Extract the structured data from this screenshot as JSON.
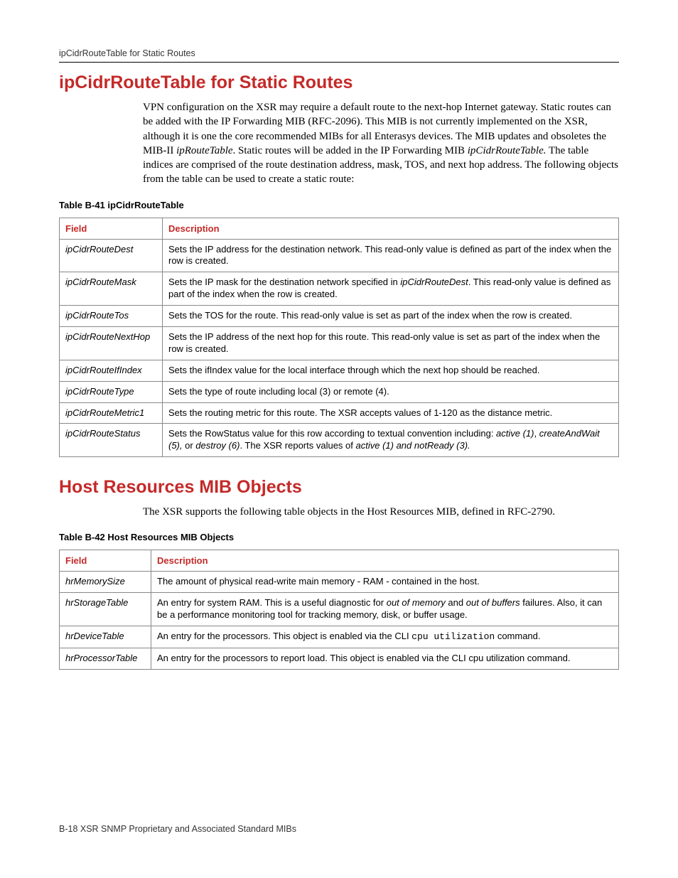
{
  "header": {
    "running": "ipCidrRouteTable for Static Routes"
  },
  "section1": {
    "title": "ipCidrRouteTable for Static Routes",
    "para_parts": [
      {
        "t": "VPN configuration on the XSR may require a default route to the next-hop Internet gateway. Static routes can be added with the IP Forwarding MIB (RFC-2096). This MIB is not currently implemented on the XSR, although it is one the core recommended MIBs for all Enterasys devices. The MIB updates and obsoletes the MIB-II "
      },
      {
        "t": "ipRouteTable",
        "i": true
      },
      {
        "t": ". Static routes will be added in the IP Forwarding MIB "
      },
      {
        "t": "ipCidrRouteTable.",
        "i": true
      },
      {
        "t": " The table indices are comprised of the route destination address, mask, TOS, and next hop address. The following objects from the table can be used to create a static route:"
      }
    ],
    "table_caption": "Table B-41   ipCidrRouteTable",
    "columns": [
      "Field",
      "Description"
    ],
    "rows": [
      {
        "field": "ipCidrRouteDest",
        "desc": [
          {
            "t": "Sets the IP address for the destination network. This read-only value is defined as part of the index when the row is created."
          }
        ]
      },
      {
        "field": "ipCidrRouteMask",
        "desc": [
          {
            "t": "Sets the IP mask for the destination network specified in "
          },
          {
            "t": "ipCidrRouteDest",
            "i": true
          },
          {
            "t": ". This read-only value is defined as part of the index when the row is created."
          }
        ]
      },
      {
        "field": "ipCidrRouteTos",
        "desc": [
          {
            "t": "Sets the TOS for the route. This read-only value is set as part of the index when the row is created."
          }
        ]
      },
      {
        "field": "ipCidrRouteNextHop",
        "desc": [
          {
            "t": "Sets the IP address of the next hop for this route. This read-only value is set as part of the index when the row is created."
          }
        ]
      },
      {
        "field": "ipCidrRouteIfIndex",
        "desc": [
          {
            "t": "Sets the ifIndex value for the local interface through which the next hop should be reached."
          }
        ]
      },
      {
        "field": "ipCidrRouteType",
        "desc": [
          {
            "t": "Sets the type of route including local (3) or remote (4)."
          }
        ]
      },
      {
        "field": "ipCidrRouteMetric1",
        "desc": [
          {
            "t": "Sets the routing metric for this route. The XSR accepts values of 1-120 as the distance metric."
          }
        ]
      },
      {
        "field": "ipCidrRouteStatus",
        "desc": [
          {
            "t": "Sets the RowStatus value for this row according to textual convention including: "
          },
          {
            "t": "active (1)",
            "i": true
          },
          {
            "t": ", "
          },
          {
            "t": "createAndWait (5),",
            "i": true
          },
          {
            "t": " or "
          },
          {
            "t": "destroy (6)",
            "i": true
          },
          {
            "t": ". The XSR reports values of "
          },
          {
            "t": "active (1) and notReady (3).",
            "i": true
          }
        ]
      }
    ]
  },
  "section2": {
    "title": "Host Resources MIB Objects",
    "para_parts": [
      {
        "t": "The XSR supports the following table objects in the Host Resources MIB, defined in RFC-2790."
      }
    ],
    "table_caption": "Table B-42   Host Resources MIB Objects",
    "columns": [
      "Field",
      "Description"
    ],
    "rows": [
      {
        "field": "hrMemorySize",
        "desc": [
          {
            "t": "The amount of physical read-write main memory - RAM - contained in the host."
          }
        ]
      },
      {
        "field": "hrStorageTable",
        "desc": [
          {
            "t": "An entry for system RAM. This is a useful diagnostic for "
          },
          {
            "t": "out of memory",
            "i": true
          },
          {
            "t": " and "
          },
          {
            "t": "out of buffers",
            "i": true
          },
          {
            "t": " failures. Also, it can be a performance monitoring tool for tracking memory, disk, or buffer usage."
          }
        ]
      },
      {
        "field": "hrDeviceTable",
        "desc": [
          {
            "t": "An entry for the processors. This object is enabled via the CLI "
          },
          {
            "t": "cpu utilization",
            "m": true
          },
          {
            "t": " command."
          }
        ]
      },
      {
        "field": "hrProcessorTable",
        "desc": [
          {
            "t": "An entry for the processors to report load. This object is enabled via the CLI cpu utilization command."
          }
        ]
      }
    ]
  },
  "footer": {
    "text": "B-18  XSR SNMP Proprietary and Associated Standard MIBs"
  }
}
